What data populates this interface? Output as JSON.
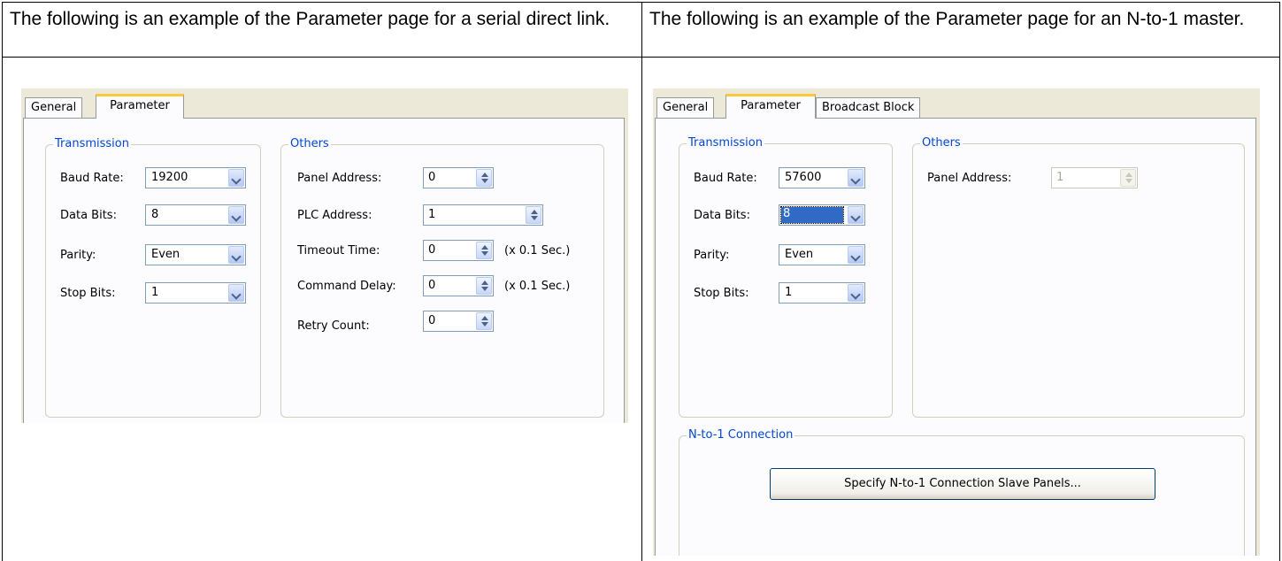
{
  "left_column": {
    "caption": "The following is an example of the Parameter page for a serial direct link.",
    "dialog": {
      "tabs": [
        "General",
        "Parameter"
      ],
      "active_tab": "Parameter",
      "transmission": {
        "title": "Transmission",
        "baud_rate": {
          "label": "Baud Rate:",
          "value": "19200"
        },
        "data_bits": {
          "label": "Data Bits:",
          "value": "8"
        },
        "parity": {
          "label": "Parity:",
          "value": "Even"
        },
        "stop_bits": {
          "label": "Stop Bits:",
          "value": "1"
        }
      },
      "others": {
        "title": "Others",
        "panel_address": {
          "label": "Panel Address:",
          "value": "0"
        },
        "plc_address": {
          "label": "PLC Address:",
          "value": "1"
        },
        "timeout_time": {
          "label": "Timeout Time:",
          "value": "0",
          "unit": "(x 0.1 Sec.)"
        },
        "command_delay": {
          "label": "Command Delay:",
          "value": "0",
          "unit": "(x 0.1 Sec.)"
        },
        "retry_count": {
          "label": "Retry Count:",
          "value": "0"
        }
      }
    }
  },
  "right_column": {
    "caption": "The following is an example of the Parameter page for an N-to-1 master.",
    "dialog": {
      "tabs": [
        "General",
        "Parameter",
        "Broadcast Block"
      ],
      "active_tab": "Parameter",
      "transmission": {
        "title": "Transmission",
        "baud_rate": {
          "label": "Baud Rate:",
          "value": "57600"
        },
        "data_bits": {
          "label": "Data Bits:",
          "value": "8"
        },
        "parity": {
          "label": "Parity:",
          "value": "Even"
        },
        "stop_bits": {
          "label": "Stop Bits:",
          "value": "1"
        }
      },
      "others": {
        "title": "Others",
        "panel_address": {
          "label": "Panel Address:",
          "value": "1"
        }
      },
      "n_to_1": {
        "title": "N-to-1 Connection",
        "button_label": "Specify N-to-1 Connection Slave Panels..."
      }
    }
  },
  "colors": {
    "group_title": "#0046D5",
    "dialog_bg": "#FCFCFE",
    "tab_highlight": "#FFC83C"
  }
}
